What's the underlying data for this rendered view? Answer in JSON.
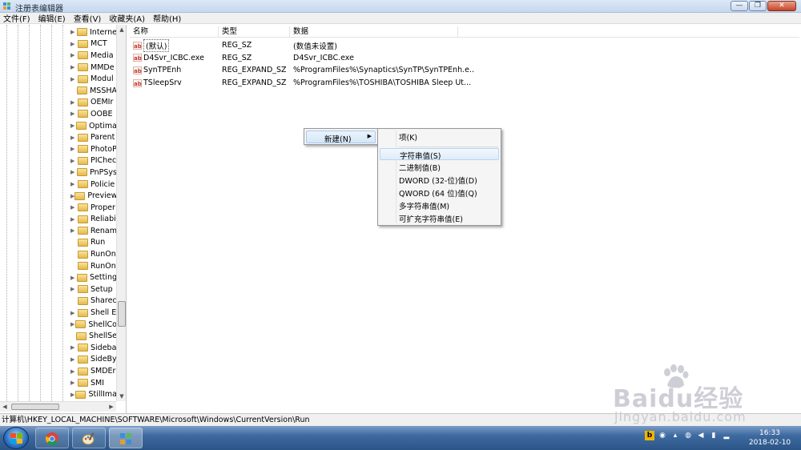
{
  "window": {
    "title": "注册表编辑器",
    "buttons": {
      "minimize": "—",
      "maximize": "❐",
      "close": "✕"
    }
  },
  "menu": [
    "文件(F)",
    "编辑(E)",
    "查看(V)",
    "收藏夹(A)",
    "帮助(H)"
  ],
  "tree": {
    "items": [
      {
        "label": "Interne",
        "expandable": true
      },
      {
        "label": "MCT",
        "expandable": true
      },
      {
        "label": "Media",
        "expandable": true
      },
      {
        "label": "MMDe",
        "expandable": true
      },
      {
        "label": "Modul",
        "expandable": true
      },
      {
        "label": "MSSHA",
        "expandable": false
      },
      {
        "label": "OEMIr",
        "expandable": true
      },
      {
        "label": "OOBE",
        "expandable": true
      },
      {
        "label": "Optima",
        "expandable": true
      },
      {
        "label": "Parent",
        "expandable": true
      },
      {
        "label": "PhotoP",
        "expandable": true
      },
      {
        "label": "PIChec",
        "expandable": true
      },
      {
        "label": "PnPSys",
        "expandable": true
      },
      {
        "label": "Policie",
        "expandable": true
      },
      {
        "label": "Preview",
        "expandable": true
      },
      {
        "label": "Proper",
        "expandable": true
      },
      {
        "label": "Reliabi",
        "expandable": true
      },
      {
        "label": "Renam",
        "expandable": true
      },
      {
        "label": "Run",
        "expandable": false,
        "selected": true
      },
      {
        "label": "RunOn",
        "expandable": false
      },
      {
        "label": "RunOn",
        "expandable": false
      },
      {
        "label": "Setting",
        "expandable": true
      },
      {
        "label": "Setup",
        "expandable": true
      },
      {
        "label": "Sharec",
        "expandable": false
      },
      {
        "label": "Shell E",
        "expandable": true
      },
      {
        "label": "ShellCo",
        "expandable": true
      },
      {
        "label": "ShellSe",
        "expandable": false
      },
      {
        "label": "Sideba",
        "expandable": true
      },
      {
        "label": "SideBy",
        "expandable": true
      },
      {
        "label": "SMDEr",
        "expandable": true
      },
      {
        "label": "SMI",
        "expandable": true
      },
      {
        "label": "StillIma",
        "expandable": true
      }
    ],
    "scroll_icons": {
      "up": "▲",
      "down": "▼",
      "left": "◀",
      "right": "▶"
    }
  },
  "list": {
    "columns": [
      "名称",
      "类型",
      "数据"
    ],
    "rows": [
      {
        "name": "(默认)",
        "type": "REG_SZ",
        "data": "(数值未设置)"
      },
      {
        "name": "D4Svr_ICBC.exe",
        "type": "REG_SZ",
        "data": "D4Svr_ICBC.exe"
      },
      {
        "name": "SynTPEnh",
        "type": "REG_EXPAND_SZ",
        "data": "%ProgramFiles%\\Synaptics\\SynTP\\SynTPEnh.e..."
      },
      {
        "name": "TSleepSrv",
        "type": "REG_EXPAND_SZ",
        "data": "%ProgramFiles%\\TOSHIBA\\TOSHIBA Sleep Ut..."
      }
    ],
    "value_icon": "ab"
  },
  "context_menu": {
    "new_label": "新建(N)",
    "arrow": "▶",
    "submenu": [
      "项(K)",
      "字符串值(S)",
      "二进制值(B)",
      "DWORD (32-位)值(D)",
      "QWORD (64 位)值(Q)",
      "多字符串值(M)",
      "可扩充字符串值(E)"
    ]
  },
  "status": {
    "path": "计算机\\HKEY_LOCAL_MACHINE\\SOFTWARE\\Microsoft\\Windows\\CurrentVersion\\Run"
  },
  "taskbar": {
    "clock_time": "16:33",
    "clock_date": "2018-02-10",
    "tray_icons": [
      "b",
      "◉",
      "▴",
      "◍",
      "◀",
      "▮",
      "▂"
    ]
  },
  "watermark": {
    "brand": "Baidu经验",
    "url": "jingyan.baidu.com"
  }
}
